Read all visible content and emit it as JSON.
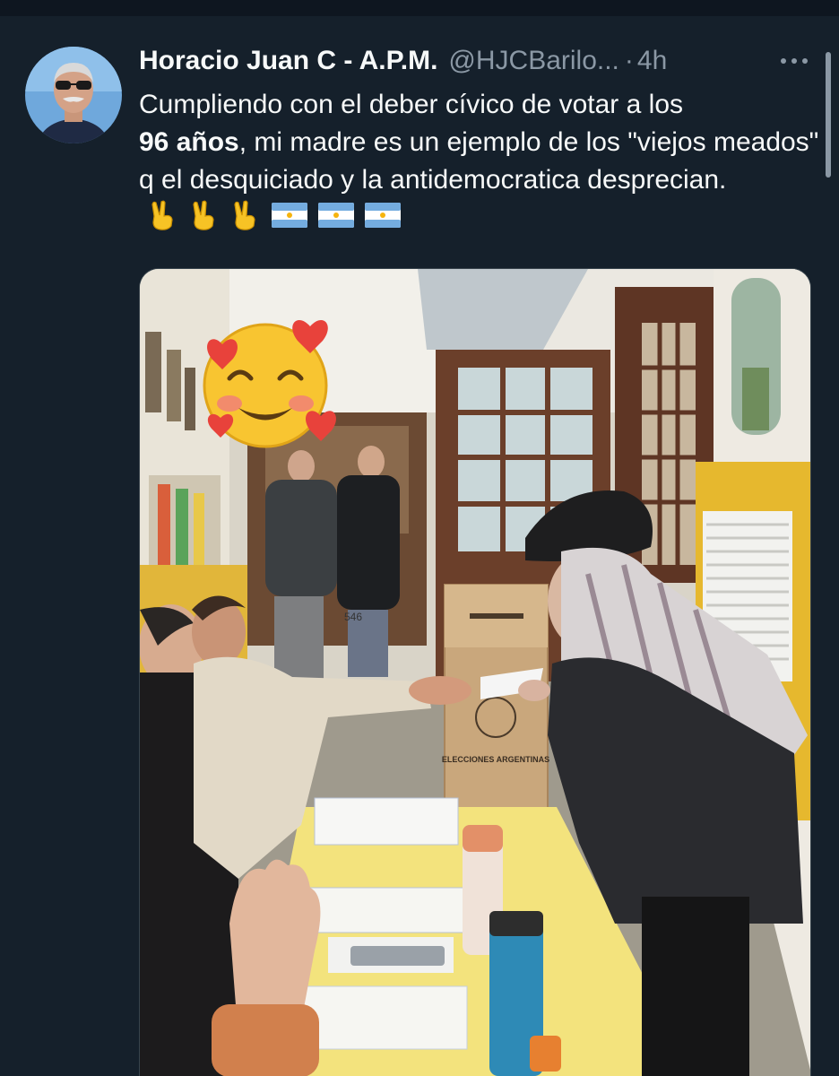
{
  "tweet": {
    "author_name": "Horacio Juan C - A.P.M.",
    "handle": "@HJCBarilo...",
    "separator": "·",
    "time": "4h",
    "text_line1": "Cumpliendo con el deber cívico de votar a los",
    "text_bold": "96 años",
    "text_line2": ", mi madre es un ejemplo de los \"viejos meados\" q el desquiciado y la antidemocratica desprecian.",
    "emojis": [
      "victory-hand",
      "victory-hand",
      "victory-hand",
      "argentina-flag",
      "argentina-flag",
      "argentina-flag"
    ],
    "media": {
      "box_label": "ELECCIONES ARGENTINAS",
      "table_number": "546"
    }
  },
  "colors": {
    "background": "#15202b",
    "text_primary": "#f7f9f9",
    "text_secondary": "#8b98a5",
    "flag_blue": "#74acdf",
    "flag_sun": "#f6b40e"
  },
  "icons": {
    "more": "more-horizontal-icon",
    "avatar": "user-avatar"
  }
}
